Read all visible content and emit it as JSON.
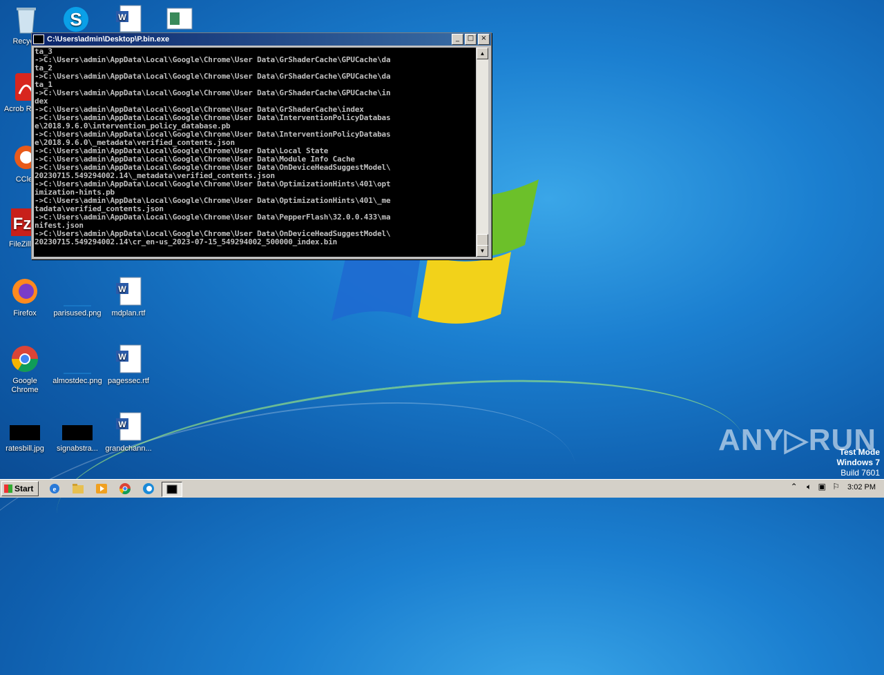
{
  "desktop": {
    "icons": [
      {
        "label": "Recycle"
      },
      {
        "label": "Acrob Reade"
      },
      {
        "label": "CClea"
      },
      {
        "label": "FileZilla"
      },
      {
        "label": "Firefox"
      },
      {
        "label": "parisused.png"
      },
      {
        "label": "mdplan.rtf"
      },
      {
        "label": "Google Chrome"
      },
      {
        "label": "almostdec.png"
      },
      {
        "label": "pagessec.rtf"
      },
      {
        "label": "ratesbill.jpg"
      },
      {
        "label": "signabstra..."
      },
      {
        "label": "grandchann..."
      }
    ]
  },
  "console_window": {
    "title": "C:\\Users\\admin\\Desktop\\P.bin.exe",
    "lines": [
      "ta_3",
      "->C:\\Users\\admin\\AppData\\Local\\Google\\Chrome\\User Data\\GrShaderCache\\GPUCache\\da",
      "ta_2",
      "->C:\\Users\\admin\\AppData\\Local\\Google\\Chrome\\User Data\\GrShaderCache\\GPUCache\\da",
      "ta_1",
      "->C:\\Users\\admin\\AppData\\Local\\Google\\Chrome\\User Data\\GrShaderCache\\GPUCache\\in",
      "dex",
      "->C:\\Users\\admin\\AppData\\Local\\Google\\Chrome\\User Data\\GrShaderCache\\index",
      "->C:\\Users\\admin\\AppData\\Local\\Google\\Chrome\\User Data\\InterventionPolicyDatabas",
      "e\\2018.9.6.0\\intervention_policy_database.pb",
      "->C:\\Users\\admin\\AppData\\Local\\Google\\Chrome\\User Data\\InterventionPolicyDatabas",
      "e\\2018.9.6.0\\_metadata\\verified_contents.json",
      "->C:\\Users\\admin\\AppData\\Local\\Google\\Chrome\\User Data\\Local State",
      "->C:\\Users\\admin\\AppData\\Local\\Google\\Chrome\\User Data\\Module Info Cache",
      "->C:\\Users\\admin\\AppData\\Local\\Google\\Chrome\\User Data\\OnDeviceHeadSuggestModel\\",
      "20230715.549294002.14\\_metadata\\verified_contents.json",
      "->C:\\Users\\admin\\AppData\\Local\\Google\\Chrome\\User Data\\OptimizationHints\\401\\opt",
      "imization-hints.pb",
      "->C:\\Users\\admin\\AppData\\Local\\Google\\Chrome\\User Data\\OptimizationHints\\401\\_me",
      "tadata\\verified_contents.json",
      "->C:\\Users\\admin\\AppData\\Local\\Google\\Chrome\\User Data\\PepperFlash\\32.0.0.433\\ma",
      "nifest.json",
      "->C:\\Users\\admin\\AppData\\Local\\Google\\Chrome\\User Data\\OnDeviceHeadSuggestModel\\",
      "20230715.549294002.14\\cr_en-us_2023-07-15_549294002_500000_index.bin"
    ],
    "buttons": {
      "minimize": "_",
      "maximize": "□",
      "close": "×"
    }
  },
  "watermark": {
    "brand": "ANY▷RUN",
    "test_mode": "Test Mode",
    "os": "Windows 7",
    "build": "Build 7601"
  },
  "taskbar": {
    "start_label": "Start",
    "clock": "3:02 PM"
  }
}
